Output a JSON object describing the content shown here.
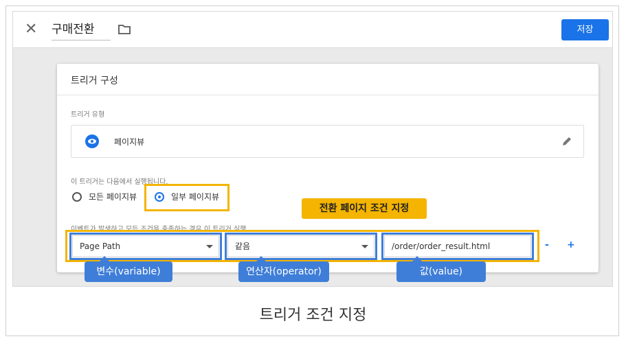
{
  "topbar": {
    "close_icon": "close-icon",
    "title": "구매전환",
    "folder_icon": "folder-icon",
    "save_label": "저장"
  },
  "card": {
    "title": "트리거 구성",
    "type_label": "트리거 유형",
    "type_value": "페이지뷰",
    "fires_label": "이 트리거는 다음에서 실행됩니다.",
    "radio_all": "모든 페이지뷰",
    "radio_some": "일부 페이지뷰",
    "condition_label": "이벤트가 발생하고 모든 조건을 충족하는 경우 이 트리거 실행",
    "variable": "Page Path",
    "operator": "같음",
    "value": "/order/order_result.html",
    "minus": "-",
    "plus": "+"
  },
  "annotations": {
    "callout": "전환 페이지 조건 지정",
    "tag_variable": "변수(variable)",
    "tag_operator": "연산자(operator)",
    "tag_value": "값(value)"
  },
  "colors": {
    "accent_blue": "#1a73e8",
    "highlight_yellow": "#f4b400",
    "label_blue": "#3f7ed8"
  },
  "caption": "트리거 조건 지정"
}
